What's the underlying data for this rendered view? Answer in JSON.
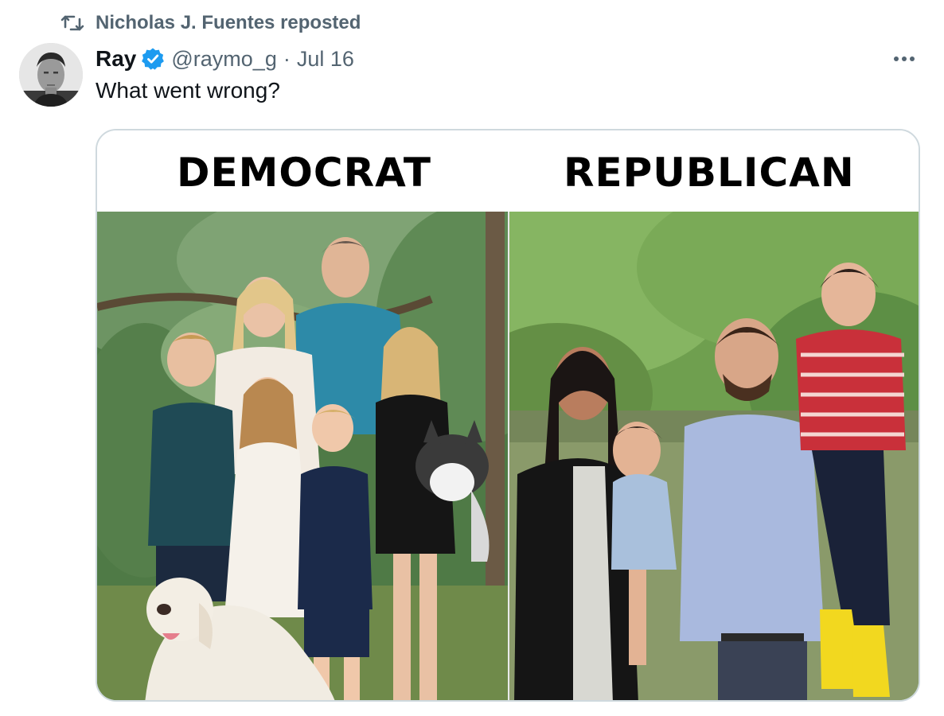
{
  "repost": {
    "text": "Nicholas J. Fuentes reposted",
    "icon": "repost-icon"
  },
  "author": {
    "name": "Ray",
    "verified": true,
    "verified_color": "#1d9bf0",
    "handle": "@raymo_g",
    "separator": "·",
    "date": "Jul 16"
  },
  "tweet": {
    "text": "What went wrong?"
  },
  "media": {
    "left_label": "DEMOCRAT",
    "right_label": "REPUBLICAN"
  },
  "colors": {
    "primary_text": "#0f1419",
    "secondary_text": "#536471",
    "border": "#cfd9de"
  }
}
